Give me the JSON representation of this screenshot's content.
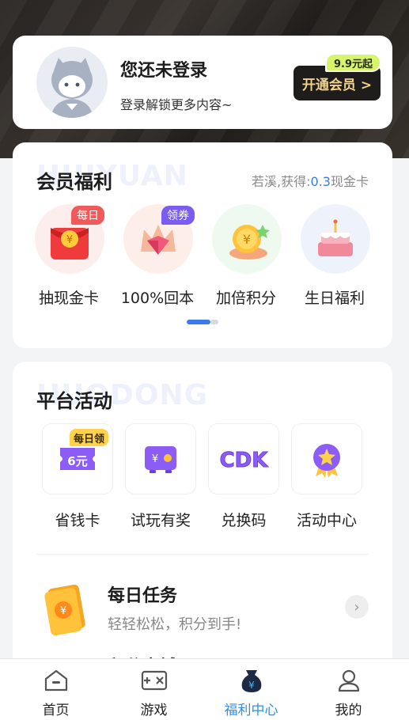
{
  "profile": {
    "title": "您还未登录",
    "subtitle": "登录解锁更多内容~",
    "vip_button": "开通会员 >",
    "vip_price_tag": "9.9元起"
  },
  "benefits": {
    "title": "会员福利",
    "watermark": "HUIYUAN",
    "earn_prefix": "若溪,获得:",
    "earn_amount": "0.3",
    "earn_suffix": "现金卡",
    "items": [
      {
        "label": "抽现金卡",
        "badge": "每日",
        "icon": "red-envelope-icon"
      },
      {
        "label": "100%回本",
        "badge": "领券",
        "icon": "diamond-crown-icon"
      },
      {
        "label": "加倍积分",
        "badge": "",
        "icon": "gold-coin-icon"
      },
      {
        "label": "生日福利",
        "badge": "",
        "icon": "birthday-cake-icon"
      }
    ],
    "page_index": 1,
    "page_count": 2
  },
  "activities": {
    "title": "平台活动",
    "watermark": "HUODONG",
    "items": [
      {
        "label": "省钱卡",
        "badge": "每日领",
        "value": "6元",
        "icon": "coupon-ticket-icon"
      },
      {
        "label": "试玩有奖",
        "badge": "",
        "value": "",
        "icon": "game-reward-icon"
      },
      {
        "label": "兑换码",
        "badge": "",
        "value": "CDK",
        "icon": "cdk-icon"
      },
      {
        "label": "活动中心",
        "badge": "",
        "value": "",
        "icon": "star-medal-icon"
      }
    ],
    "task_title": "每日任务",
    "task_sub": "轻轻松松，积分到手!",
    "next_partial": "积分商城"
  },
  "tabbar": {
    "items": [
      {
        "label": "首页",
        "icon": "home-icon"
      },
      {
        "label": "游戏",
        "icon": "game-icon"
      },
      {
        "label": "福利中心",
        "icon": "welfare-bag-icon",
        "active": true
      },
      {
        "label": "我的",
        "icon": "user-icon"
      }
    ]
  },
  "colors": {
    "accent": "#3b7bf0",
    "tab_active": "#2f8fe8",
    "vip_gold": "#f3d38a",
    "vip_tag": "#d7f56a",
    "badge_red": "#f05a5a",
    "badge_purple": "#7b5cf0"
  }
}
